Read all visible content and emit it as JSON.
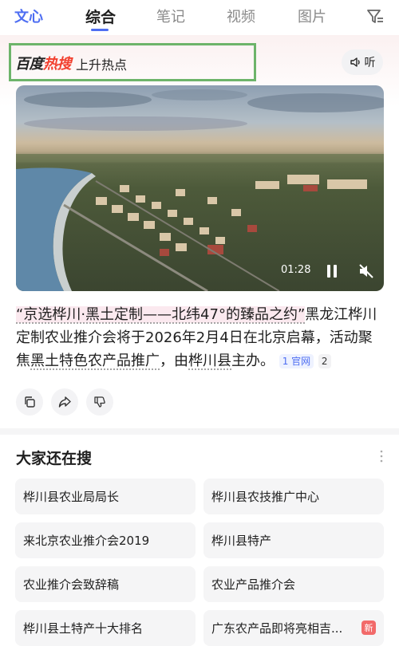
{
  "tabs": {
    "wenxin": "文心",
    "items": [
      "综合",
      "笔记",
      "视频",
      "图片"
    ]
  },
  "hot": {
    "logo_black": "百度",
    "logo_red": "热搜",
    "title": "上升热点",
    "listen_label": "听"
  },
  "video": {
    "time": "01:28"
  },
  "article": {
    "quote": "“京选桦川·黑土定制——北纬47°的臻品之约”",
    "part1": "黑龙江桦川定制农业推介会将于2026年2月4日在北京启幕，活动聚焦",
    "highlight": "黑土特色农产品推广",
    "part2": "，由",
    "host": "桦川县",
    "part3": "主办。",
    "source_label": "1 官网",
    "source_count": "2"
  },
  "related": {
    "title": "大家还在搜",
    "items": [
      "桦川县农业局局长",
      "桦川县农技推广中心",
      "来北京农业推介会2019",
      "桦川县特产",
      "农业推介会致辞稿",
      "农业产品推介会",
      "桦川县土特产十大排名",
      "广东农产品即将亮相吉..."
    ],
    "new_badge": "新"
  },
  "colors": {
    "accent": "#4e6ef2",
    "hot_red": "#f2402f",
    "highlight_box": "#6db46a"
  }
}
